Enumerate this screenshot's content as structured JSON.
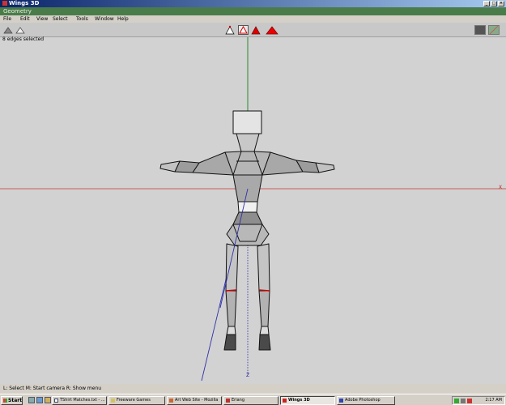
{
  "window": {
    "title": "Wings 3D"
  },
  "geometry_bar": {
    "label": "Geometry"
  },
  "menu": [
    "File",
    "Edit",
    "View",
    "Select",
    "Tools",
    "Window",
    "Help"
  ],
  "status": {
    "selection": "8 edges selected"
  },
  "viewport": {
    "axis_label_z": "Z",
    "axis_label_x": "X",
    "colors": {
      "x_axis": "#cc2020",
      "y_axis": "#208020",
      "z_axis": "#2020a0",
      "edge_selected": "#cc0000"
    }
  },
  "info_bar": {
    "text": "L: Select   M: Start camera   R: Show menu"
  },
  "taskbar": {
    "start_label": "Start",
    "tasks": [
      {
        "label": "TShirt Matches.txt - ..."
      },
      {
        "label": "Freeware Games"
      },
      {
        "label": "Art Web Site - Mozilla"
      },
      {
        "label": "Eriang"
      },
      {
        "label": "Wings 3D"
      },
      {
        "label": "Adobe Photoshop"
      }
    ],
    "clock": "2:17 AM"
  }
}
